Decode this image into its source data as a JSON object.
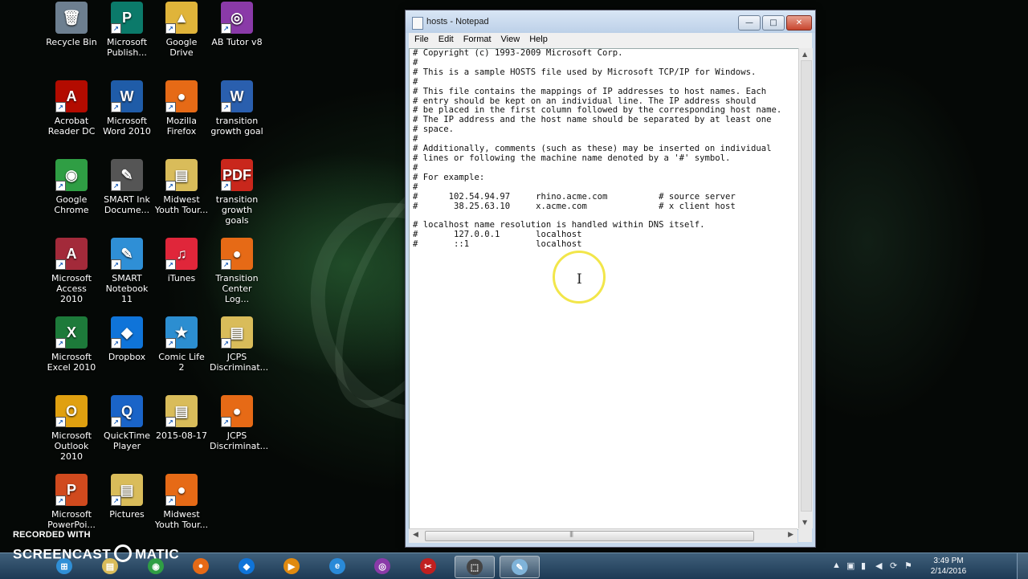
{
  "desktop": {
    "icons": [
      {
        "label": "Recycle Bin",
        "icon": "recycle-bin-icon",
        "color": "#6d7f90",
        "glyph": "🗑"
      },
      {
        "label": "Microsoft Publish...",
        "icon": "publisher-icon",
        "color": "#0b7a6a",
        "glyph": "P"
      },
      {
        "label": "Google Drive",
        "icon": "google-drive-icon",
        "color": "#e0b43a",
        "glyph": "▲"
      },
      {
        "label": "AB Tutor v8",
        "icon": "ab-tutor-icon",
        "color": "#8a3aa8",
        "glyph": "◎"
      },
      {
        "label": "Acrobat Reader DC",
        "icon": "acrobat-icon",
        "color": "#b30b00",
        "glyph": "A"
      },
      {
        "label": "Microsoft Word 2010",
        "icon": "word-icon",
        "color": "#1f5ca8",
        "glyph": "W"
      },
      {
        "label": "Mozilla Firefox",
        "icon": "firefox-icon",
        "color": "#e66a16",
        "glyph": "●"
      },
      {
        "label": "transition growth goal",
        "icon": "word-document-icon",
        "color": "#2a5fae",
        "glyph": "W"
      },
      {
        "label": "Google Chrome",
        "icon": "chrome-icon",
        "color": "#2f9e44",
        "glyph": "◉"
      },
      {
        "label": "SMART Ink Docume...",
        "icon": "smart-ink-icon",
        "color": "#555555",
        "glyph": "✎"
      },
      {
        "label": "Midwest Youth Tour...",
        "icon": "folder-icon",
        "color": "#d9bc5a",
        "glyph": "▤"
      },
      {
        "label": "transition growth goals",
        "icon": "pdf-icon",
        "color": "#c9271c",
        "glyph": "PDF"
      },
      {
        "label": "Microsoft Access 2010",
        "icon": "access-icon",
        "color": "#a32a3a",
        "glyph": "A"
      },
      {
        "label": "SMART Notebook 11",
        "icon": "smart-notebook-icon",
        "color": "#2f8fd6",
        "glyph": "✎"
      },
      {
        "label": "iTunes",
        "icon": "itunes-icon",
        "color": "#e0263a",
        "glyph": "♫"
      },
      {
        "label": "Transition Center Log...",
        "icon": "firefox-document-icon",
        "color": "#e66a16",
        "glyph": "●"
      },
      {
        "label": "Microsoft Excel 2010",
        "icon": "excel-icon",
        "color": "#1d7a3a",
        "glyph": "X"
      },
      {
        "label": "Dropbox",
        "icon": "dropbox-icon",
        "color": "#0f74d9",
        "glyph": "◆"
      },
      {
        "label": "Comic Life 2",
        "icon": "comic-life-icon",
        "color": "#2c8ed1",
        "glyph": "★"
      },
      {
        "label": "JCPS Discriminat...",
        "icon": "folder-icon",
        "color": "#d9bc5a",
        "glyph": "▤"
      },
      {
        "label": "Microsoft Outlook 2010",
        "icon": "outlook-icon",
        "color": "#e0a010",
        "glyph": "O"
      },
      {
        "label": "QuickTime Player",
        "icon": "quicktime-icon",
        "color": "#1a64c8",
        "glyph": "Q"
      },
      {
        "label": "2015-08-17",
        "icon": "folder-icon",
        "color": "#d9bc5a",
        "glyph": "▤"
      },
      {
        "label": "JCPS Discriminat...",
        "icon": "firefox-document-icon",
        "color": "#e66a16",
        "glyph": "●"
      },
      {
        "label": "Microsoft PowerPoi...",
        "icon": "powerpoint-icon",
        "color": "#d04a1e",
        "glyph": "P"
      },
      {
        "label": "Pictures",
        "icon": "folder-icon",
        "color": "#d9bc5a",
        "glyph": "▤"
      },
      {
        "label": "Midwest Youth Tour...",
        "icon": "firefox-document-icon",
        "color": "#e66a16",
        "glyph": "●"
      }
    ]
  },
  "notepad": {
    "title": "hosts - Notepad",
    "menu": [
      "File",
      "Edit",
      "Format",
      "View",
      "Help"
    ],
    "content": "# Copyright (c) 1993-2009 Microsoft Corp.\n#\n# This is a sample HOSTS file used by Microsoft TCP/IP for Windows.\n#\n# This file contains the mappings of IP addresses to host names. Each\n# entry should be kept on an individual line. The IP address should\n# be placed in the first column followed by the corresponding host name.\n# The IP address and the host name should be separated by at least one\n# space.\n#\n# Additionally, comments (such as these) may be inserted on individual\n# lines or following the machine name denoted by a '#' symbol.\n#\n# For example:\n#\n#      102.54.94.97     rhino.acme.com          # source server\n#       38.25.63.10     x.acme.com              # x client host\n\n# localhost name resolution is handled within DNS itself.\n#\t127.0.0.1       localhost\n#\t::1             localhost",
    "buttons": {
      "minimize": "—",
      "maximize": "□",
      "close": "✕"
    }
  },
  "taskbar": {
    "apps": [
      {
        "name": "start-button",
        "glyph": "⊞",
        "color": "#2f8fd6"
      },
      {
        "name": "explorer",
        "glyph": "▤",
        "color": "#d9bc5a"
      },
      {
        "name": "chrome",
        "glyph": "◉",
        "color": "#2f9e44"
      },
      {
        "name": "firefox",
        "glyph": "●",
        "color": "#e66a16"
      },
      {
        "name": "dropbox",
        "glyph": "◆",
        "color": "#0f74d9"
      },
      {
        "name": "media-player",
        "glyph": "▶",
        "color": "#e08a10"
      },
      {
        "name": "internet-explorer",
        "glyph": "e",
        "color": "#2a8ad8"
      },
      {
        "name": "ab-tutor",
        "glyph": "◎",
        "color": "#8a3aa8"
      },
      {
        "name": "snipping-tool",
        "glyph": "✂",
        "color": "#c02020"
      },
      {
        "name": "screen-region",
        "glyph": "⬚",
        "color": "#444444"
      },
      {
        "name": "notepad",
        "glyph": "✎",
        "color": "#7fb3d9"
      }
    ],
    "clock": {
      "time": "3:49 PM",
      "date": "2/14/2016"
    }
  },
  "watermark": {
    "line1": "RECORDED WITH",
    "line2a": "SCREENCAST",
    "line2b": "MATIC"
  }
}
